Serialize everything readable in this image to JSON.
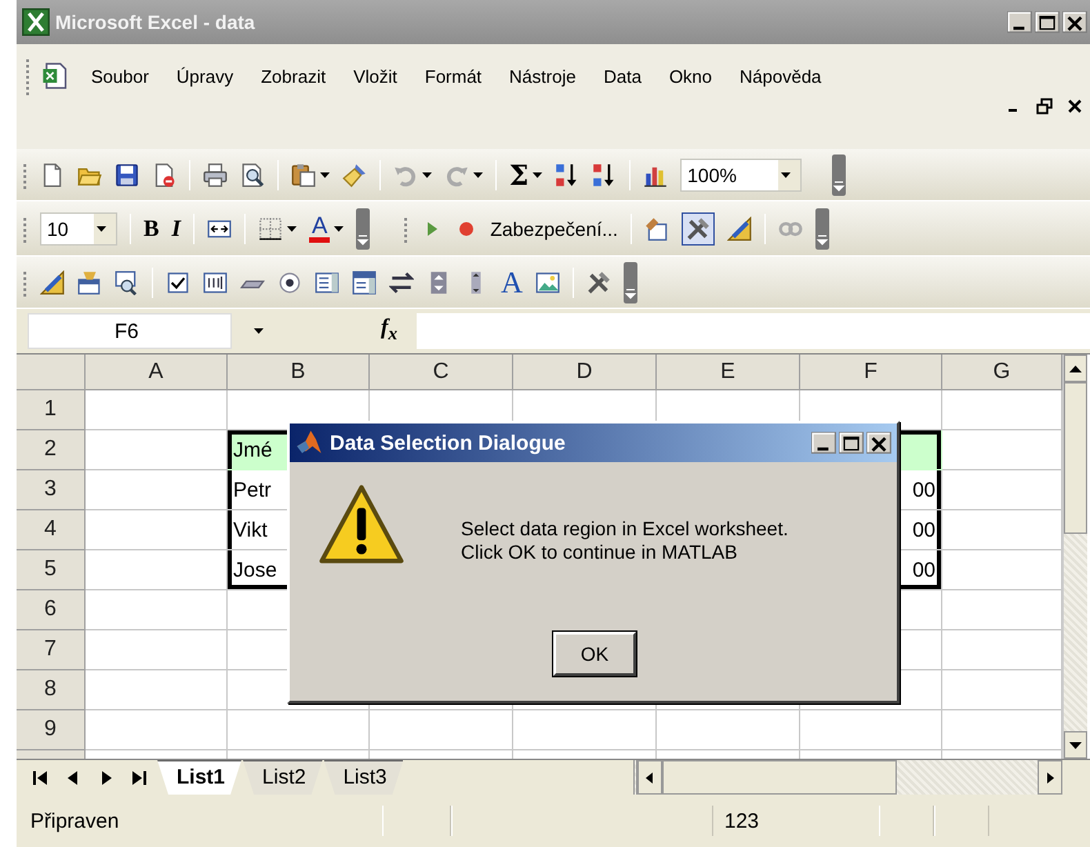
{
  "window": {
    "title": "Microsoft Excel - data"
  },
  "menu": [
    {
      "label": "Soubor"
    },
    {
      "label": "Úpravy"
    },
    {
      "label": "Zobrazit"
    },
    {
      "label": "Vložit"
    },
    {
      "label": "Formát"
    },
    {
      "label": "Nástroje"
    },
    {
      "label": "Data"
    },
    {
      "label": "Okno"
    },
    {
      "label": "Nápověda"
    }
  ],
  "standard_toolbar": {
    "sum": "Σ",
    "zoom": "100%"
  },
  "formatting_toolbar": {
    "font_size": "10",
    "bold": "B",
    "italic": "I",
    "font_color": "A"
  },
  "control_toolbox": {
    "security": "Zabezpečení...",
    "design_mode": true
  },
  "forms_toolbar": {
    "label_tool": "A"
  },
  "formula_bar": {
    "name_box": "F6",
    "function_label": "f$_{x}$"
  },
  "sheet": {
    "columns": [
      "A",
      "B",
      "C",
      "D",
      "E",
      "F",
      "G"
    ],
    "rows": [
      {
        "header": "1",
        "cells": [
          {},
          {},
          {},
          {},
          {},
          {},
          {}
        ]
      },
      {
        "header": "2",
        "cells": [
          {},
          {
            "text": "Jmé",
            "highlighted": true,
            "border": {
              "top": true,
              "left": true
            }
          },
          {},
          {},
          {},
          {
            "highlighted": true,
            "border": {
              "top": true,
              "right": true
            }
          },
          {}
        ]
      },
      {
        "header": "3",
        "cells": [
          {},
          {
            "text": "Petr",
            "border": {
              "left": true
            }
          },
          {},
          {},
          {},
          {
            "text": "00",
            "kind": "number",
            "border": {
              "right": true
            }
          },
          {}
        ]
      },
      {
        "header": "4",
        "cells": [
          {},
          {
            "text": "Vikt",
            "border": {
              "left": true
            }
          },
          {},
          {},
          {},
          {
            "text": "00",
            "kind": "number",
            "border": {
              "right": true
            }
          },
          {}
        ]
      },
      {
        "header": "5",
        "cells": [
          {},
          {
            "text": "Jose",
            "border": {
              "left": true,
              "bottom": true
            }
          },
          {},
          {},
          {},
          {
            "text": "00",
            "kind": "number",
            "border": {
              "right": true,
              "bottom": true
            }
          },
          {}
        ]
      },
      {
        "header": "6",
        "cells": [
          {},
          {},
          {},
          {},
          {},
          {},
          {}
        ]
      },
      {
        "header": "7",
        "cells": [
          {},
          {},
          {},
          {},
          {},
          {},
          {}
        ]
      },
      {
        "header": "8",
        "cells": [
          {},
          {},
          {},
          {},
          {},
          {},
          {}
        ]
      },
      {
        "header": "9",
        "cells": [
          {},
          {},
          {},
          {},
          {},
          {},
          {}
        ]
      }
    ]
  },
  "sheet_tabs": [
    {
      "label": "List1",
      "selected": true
    },
    {
      "label": "List2",
      "selected": false
    },
    {
      "label": "List3",
      "selected": false
    }
  ],
  "status_bar": {
    "mode": "Připraven",
    "sum": "123"
  },
  "dialog": {
    "title": "Data Selection Dialogue",
    "message": [
      "Select data region in Excel worksheet.",
      "Click OK to continue in MATLAB"
    ],
    "buttons": [
      "OK"
    ]
  }
}
